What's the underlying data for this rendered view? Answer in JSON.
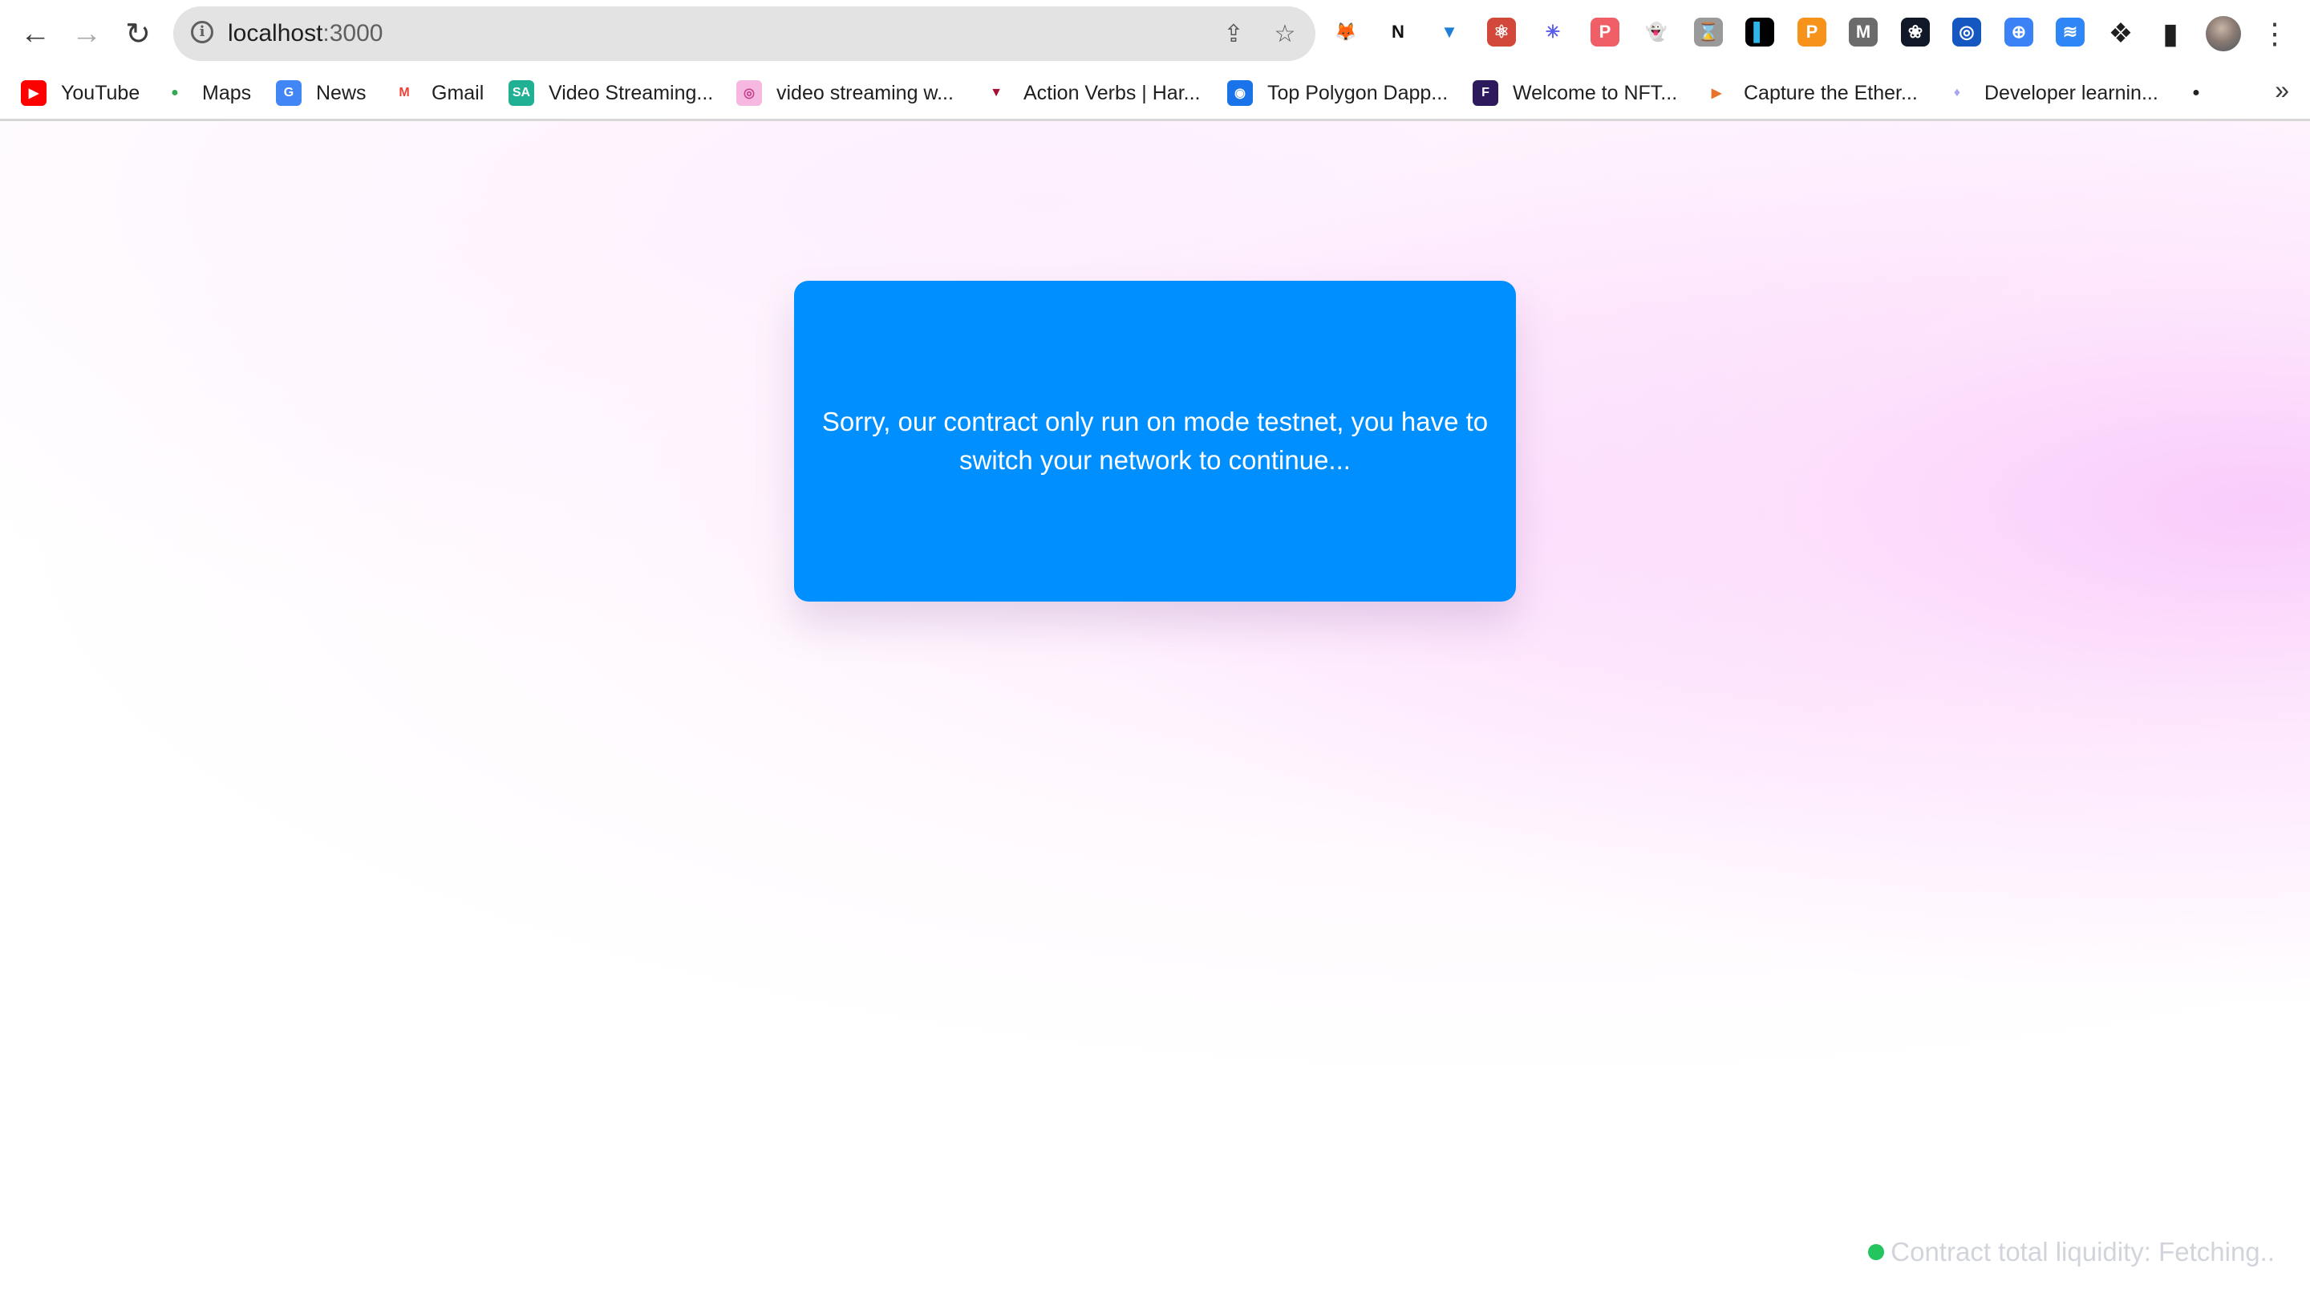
{
  "browser": {
    "nav": {
      "back_icon": "←",
      "forward_icon": "→",
      "reload_icon": "↻"
    },
    "omnibox": {
      "host": "localhost",
      "port": ":3000",
      "info_icon": "i",
      "share_icon": "⇪",
      "bookmark_icon": "☆"
    },
    "extensions": [
      {
        "name": "metamask-extension-icon",
        "glyph": "🦊",
        "bg": "#ffffff",
        "color": "#e8821e"
      },
      {
        "name": "notion-extension-icon",
        "glyph": "N",
        "bg": "#ffffff",
        "color": "#111111"
      },
      {
        "name": "funnel-extension-icon",
        "glyph": "▼",
        "bg": "#ffffff",
        "color": "#1e7fd6"
      },
      {
        "name": "react-devtools-extension-icon",
        "glyph": "⚛",
        "bg": "#d2483a",
        "color": "#ffffff"
      },
      {
        "name": "asterisk-extension-icon",
        "glyph": "✳",
        "bg": "#ffffff",
        "color": "#5b5bf0"
      },
      {
        "name": "pocket-extension-icon",
        "glyph": "P",
        "bg": "#f15f66",
        "color": "#ffffff"
      },
      {
        "name": "phantom-extension-icon",
        "glyph": "👻",
        "bg": "#ffffff",
        "color": "#ab9ff2"
      },
      {
        "name": "hourglass-extension-icon",
        "glyph": "⌛",
        "bg": "#9a9a9a",
        "color": "#ffffff"
      },
      {
        "name": "wallet-extension-icon",
        "glyph": "▌",
        "bg": "#000000",
        "color": "#2fb6e8"
      },
      {
        "name": "polkadot-extension-icon",
        "glyph": "P",
        "bg": "#f7931a",
        "color": "#ffffff"
      },
      {
        "name": "m-extension-icon",
        "glyph": "M",
        "bg": "#6b6b6b",
        "color": "#ffffff"
      },
      {
        "name": "chatgpt-extension-icon",
        "glyph": "❀",
        "bg": "#111827",
        "color": "#ffffff"
      },
      {
        "name": "radar-extension-icon",
        "glyph": "◎",
        "bg": "#1457c0",
        "color": "#ffffff"
      },
      {
        "name": "compass-extension-icon",
        "glyph": "⊕",
        "bg": "#3b82f6",
        "color": "#ffffff"
      },
      {
        "name": "wave-extension-icon",
        "glyph": "≋",
        "bg": "#2f86f6",
        "color": "#ffffff"
      }
    ],
    "extensions_menu_icon": "❖",
    "sidepanel_icon": "▮",
    "menu_icon": "⋮",
    "bookmarks": [
      {
        "label": "YouTube",
        "icon": "▶",
        "bg": "#ff0000",
        "color": "#ffffff",
        "name": "youtube"
      },
      {
        "label": "Maps",
        "icon": "●",
        "bg": "#ffffff",
        "color": "#34a853",
        "name": "maps"
      },
      {
        "label": "News",
        "icon": "G",
        "bg": "#4285f4",
        "color": "#ffffff",
        "name": "news"
      },
      {
        "label": "Gmail",
        "icon": "M",
        "bg": "#ffffff",
        "color": "#ea4335",
        "name": "gmail"
      },
      {
        "label": "Video Streaming...",
        "icon": "SA",
        "bg": "#20b093",
        "color": "#ffffff",
        "name": "video-streaming"
      },
      {
        "label": "video streaming w...",
        "icon": "◎",
        "bg": "#f6b7e0",
        "color": "#c2418c",
        "name": "video-streaming-w"
      },
      {
        "label": "Action Verbs | Har...",
        "icon": "▼",
        "bg": "#ffffff",
        "color": "#a41034",
        "name": "action-verbs"
      },
      {
        "label": "Top Polygon Dapp...",
        "icon": "◉",
        "bg": "#1a73e8",
        "color": "#ffffff",
        "name": "top-polygon-dapps"
      },
      {
        "label": "Welcome to NFT...",
        "icon": "F",
        "bg": "#2d1a5c",
        "color": "#ffffff",
        "name": "welcome-to-nft"
      },
      {
        "label": "Capture the Ether...",
        "icon": "▶",
        "bg": "#ffffff",
        "color": "#e8732a",
        "name": "capture-the-ether"
      },
      {
        "label": "Developer learnin...",
        "icon": "♦",
        "bg": "#ffffff",
        "color": "#a9a6f0",
        "name": "developer-learning"
      },
      {
        "label": "",
        "icon": "●",
        "bg": "#ffffff",
        "color": "#222222",
        "name": "globe"
      }
    ],
    "bookmarks_more": "»"
  },
  "page": {
    "message": "Sorry, our contract only run on mode testnet, you have to switch your network to continue...",
    "status": {
      "text": "Contract total liquidity: Fetching..",
      "dot_color": "#22c55e"
    },
    "accent_color": "#008ffe"
  }
}
